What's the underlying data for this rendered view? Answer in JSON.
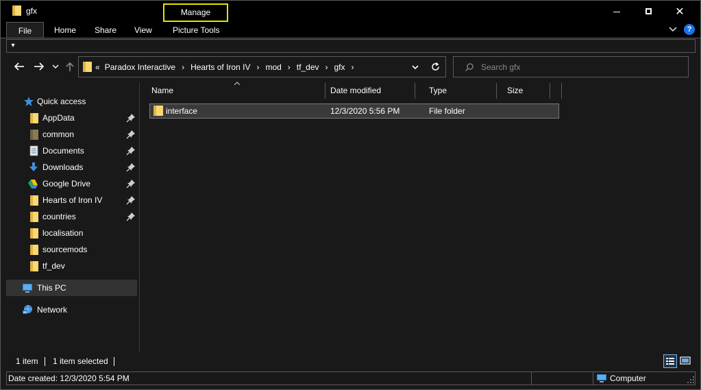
{
  "window": {
    "title": "gfx",
    "context_tab": "Manage"
  },
  "ribbon": {
    "tabs": [
      "File",
      "Home",
      "Share",
      "View",
      "Picture Tools"
    ]
  },
  "qat": {
    "button": "▾"
  },
  "address": {
    "overflow": "«",
    "crumbs": [
      "Paradox Interactive",
      "Hearts of Iron IV",
      "mod",
      "tf_dev",
      "gfx"
    ],
    "trailing_chevron": "›"
  },
  "search": {
    "placeholder": "Search gfx"
  },
  "sidebar": {
    "quick_access": "Quick access",
    "items": [
      {
        "label": "AppData",
        "icon": "folder-icon",
        "pinned": true
      },
      {
        "label": "common",
        "icon": "folder-icon",
        "pinned": true
      },
      {
        "label": "Documents",
        "icon": "documents-icon",
        "pinned": true
      },
      {
        "label": "Downloads",
        "icon": "downloads-icon",
        "pinned": true
      },
      {
        "label": "Google Drive",
        "icon": "google-drive-icon",
        "pinned": true
      },
      {
        "label": "Hearts of Iron IV",
        "icon": "folder-icon",
        "pinned": true
      },
      {
        "label": "countries",
        "icon": "folder-icon",
        "pinned": true
      },
      {
        "label": "localisation",
        "icon": "folder-icon",
        "pinned": false
      },
      {
        "label": "sourcemods",
        "icon": "folder-icon",
        "pinned": false
      },
      {
        "label": "tf_dev",
        "icon": "folder-icon",
        "pinned": false
      }
    ],
    "this_pc": "This PC",
    "network": "Network"
  },
  "columns": {
    "name": "Name",
    "date": "Date modified",
    "type": "Type",
    "size": "Size"
  },
  "rows": [
    {
      "name": "interface",
      "date": "12/3/2020 5:56 PM",
      "type": "File folder",
      "size": ""
    }
  ],
  "status": {
    "count": "1 item",
    "selected": "1 item selected"
  },
  "infobar": {
    "details": "Date created: 12/3/2020 5:54 PM",
    "location": "Computer"
  },
  "colors": {
    "background": "#191919",
    "titlebar": "#000000",
    "accent": "#e5e500",
    "folder": "#f8d775"
  }
}
